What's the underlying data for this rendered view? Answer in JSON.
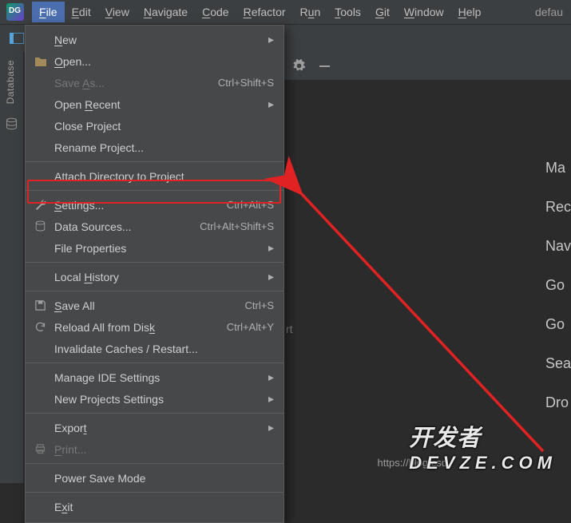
{
  "menubar": {
    "items": [
      {
        "pre": "",
        "u": "F",
        "post": "ile"
      },
      {
        "pre": "",
        "u": "E",
        "post": "dit"
      },
      {
        "pre": "",
        "u": "V",
        "post": "iew"
      },
      {
        "pre": "",
        "u": "N",
        "post": "avigate"
      },
      {
        "pre": "",
        "u": "C",
        "post": "ode"
      },
      {
        "pre": "",
        "u": "R",
        "post": "efactor"
      },
      {
        "pre": "R",
        "u": "u",
        "post": "n"
      },
      {
        "pre": "",
        "u": "T",
        "post": "ools"
      },
      {
        "pre": "",
        "u": "G",
        "post": "it"
      },
      {
        "pre": "",
        "u": "W",
        "post": "indow"
      },
      {
        "pre": "",
        "u": "H",
        "post": "elp"
      }
    ],
    "right_text": "defau"
  },
  "left_panel": {
    "label": "Database"
  },
  "file_menu": {
    "items": [
      {
        "label_pre": "",
        "u": "N",
        "label_post": "ew",
        "shortcut": "",
        "icon": "",
        "submenu": true,
        "disabled": false
      },
      {
        "label_pre": "",
        "u": "O",
        "label_post": "pen...",
        "shortcut": "",
        "icon": "folder",
        "submenu": false,
        "disabled": false
      },
      {
        "label_pre": "Save ",
        "u": "A",
        "label_post": "s...",
        "shortcut": "Ctrl+Shift+S",
        "icon": "",
        "submenu": false,
        "disabled": true
      },
      {
        "label_pre": "Open ",
        "u": "R",
        "label_post": "ecent",
        "shortcut": "",
        "icon": "",
        "submenu": true,
        "disabled": false
      },
      {
        "label_pre": "Close Pro",
        "u": "j",
        "label_post": "ect",
        "shortcut": "",
        "icon": "",
        "submenu": false,
        "disabled": false
      },
      {
        "label_pre": "Rename Project...",
        "u": "",
        "label_post": "",
        "shortcut": "",
        "icon": "",
        "submenu": false,
        "disabled": false
      },
      {
        "sep": true
      },
      {
        "label_pre": "Attach Directory to Project",
        "u": "",
        "label_post": "",
        "shortcut": "",
        "icon": "",
        "submenu": false,
        "disabled": false
      },
      {
        "sep": true
      },
      {
        "label_pre": "",
        "u": "S",
        "label_post": "ettings...",
        "shortcut": "Ctrl+Alt+S",
        "icon": "wrench",
        "submenu": false,
        "disabled": false,
        "highlighted": true
      },
      {
        "label_pre": "Data Sources...",
        "u": "",
        "label_post": "",
        "shortcut": "Ctrl+Alt+Shift+S",
        "icon": "db",
        "submenu": false,
        "disabled": false
      },
      {
        "label_pre": "File Properties",
        "u": "",
        "label_post": "",
        "shortcut": "",
        "icon": "",
        "submenu": true,
        "disabled": false
      },
      {
        "sep": true
      },
      {
        "label_pre": "Local ",
        "u": "H",
        "label_post": "istory",
        "shortcut": "",
        "icon": "",
        "submenu": true,
        "disabled": false
      },
      {
        "sep": true
      },
      {
        "label_pre": "",
        "u": "S",
        "label_post": "ave All",
        "shortcut": "Ctrl+S",
        "icon": "save",
        "submenu": false,
        "disabled": false
      },
      {
        "label_pre": "Reload All from Dis",
        "u": "k",
        "label_post": "",
        "shortcut": "Ctrl+Alt+Y",
        "icon": "reload",
        "submenu": false,
        "disabled": false
      },
      {
        "label_pre": "Invalidate Caches / Restart...",
        "u": "",
        "label_post": "",
        "shortcut": "",
        "icon": "",
        "submenu": false,
        "disabled": false
      },
      {
        "sep": true
      },
      {
        "label_pre": "Manage IDE Settings",
        "u": "",
        "label_post": "",
        "shortcut": "",
        "icon": "",
        "submenu": true,
        "disabled": false
      },
      {
        "label_pre": "New Projects Settings",
        "u": "",
        "label_post": "",
        "shortcut": "",
        "icon": "",
        "submenu": true,
        "disabled": false
      },
      {
        "sep": true
      },
      {
        "label_pre": "Expor",
        "u": "t",
        "label_post": "",
        "shortcut": "",
        "icon": "",
        "submenu": true,
        "disabled": false
      },
      {
        "label_pre": "",
        "u": "P",
        "label_post": "rint...",
        "shortcut": "",
        "icon": "print",
        "submenu": false,
        "disabled": true
      },
      {
        "sep": true
      },
      {
        "label_pre": "Power Save Mode",
        "u": "",
        "label_post": "",
        "shortcut": "",
        "icon": "",
        "submenu": false,
        "disabled": false
      },
      {
        "sep": true
      },
      {
        "label_pre": "E",
        "u": "x",
        "label_post": "it",
        "shortcut": "",
        "icon": "",
        "submenu": false,
        "disabled": false
      }
    ]
  },
  "right_hints": [
    "Ma",
    "Rec",
    "Nav",
    "Go",
    "Go",
    "Sea",
    "Dro"
  ],
  "behind_text": "rt",
  "watermark": {
    "line1": "开发者",
    "line2": "DEVZE.COM",
    "url": "https://blog.csd"
  }
}
